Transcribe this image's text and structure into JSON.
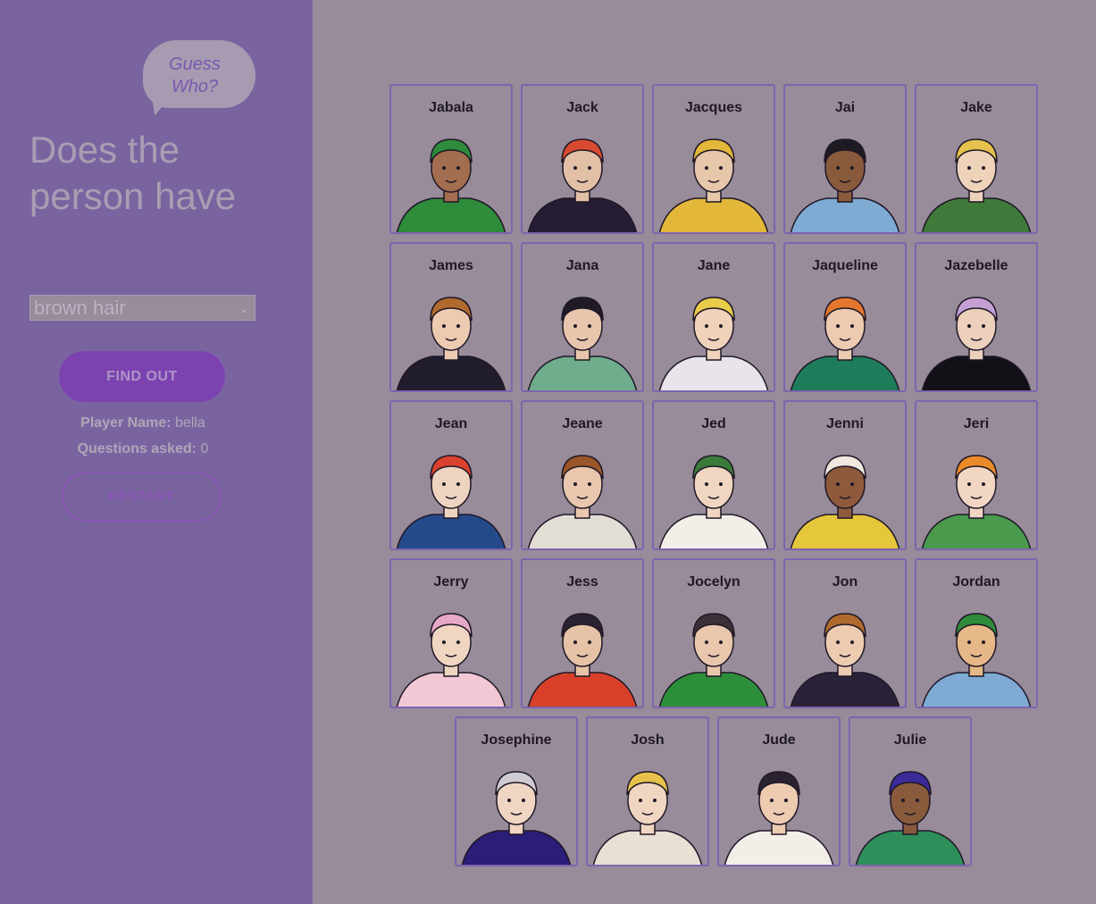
{
  "game": {
    "bubble_line1": "Guess",
    "bubble_line2": "Who?",
    "question": "Does the person have",
    "select_value": "brown hair",
    "find_out_label": "FIND OUT",
    "player_name_label": "Player Name:",
    "player_name": "bella",
    "questions_label": "Questions asked:",
    "questions_count": "0",
    "restart_label": "RESTART"
  },
  "characters": [
    {
      "name": "Jabala",
      "skin": "#a36d4f",
      "hair": "#2e8c3a",
      "shirt": "#2e8c3a"
    },
    {
      "name": "Jack",
      "skin": "#e2c0a6",
      "hair": "#d94a30",
      "shirt": "#241d33"
    },
    {
      "name": "Jacques",
      "skin": "#e7c7aa",
      "hair": "#e3b83a",
      "shirt": "#e3b83a"
    },
    {
      "name": "Jai",
      "skin": "#8a5a3c",
      "hair": "#1e1a22",
      "shirt": "#7eaad3"
    },
    {
      "name": "Jake",
      "skin": "#eed2ba",
      "hair": "#e6c24c",
      "shirt": "#3f7a3a"
    },
    {
      "name": "James",
      "skin": "#eccbb1",
      "hair": "#b06a2e",
      "shirt": "#211c2e"
    },
    {
      "name": "Jana",
      "skin": "#e8c6ad",
      "hair": "#1f1a24",
      "shirt": "#6fae8c"
    },
    {
      "name": "Jane",
      "skin": "#f0d2bb",
      "hair": "#e9cc4a",
      "shirt": "#e8e4ea"
    },
    {
      "name": "Jaqueline",
      "skin": "#eccbb1",
      "hair": "#e2772d",
      "shirt": "#1f7c5a"
    },
    {
      "name": "Jazebelle",
      "skin": "#ecd0bb",
      "hair": "#c4a0d4",
      "shirt": "#141018"
    },
    {
      "name": "Jean",
      "skin": "#eed3c0",
      "hair": "#d9422c",
      "shirt": "#254a8a"
    },
    {
      "name": "Jeane",
      "skin": "#e8c7ae",
      "hair": "#9a5528",
      "shirt": "#e2ddd5"
    },
    {
      "name": "Jed",
      "skin": "#f0d6c1",
      "hair": "#3a7a3a",
      "shirt": "#f2efe8"
    },
    {
      "name": "Jenni",
      "skin": "#8f5a3c",
      "hair": "#efe9e0",
      "shirt": "#e6c63a"
    },
    {
      "name": "Jeri",
      "skin": "#f1d7c3",
      "hair": "#ea8a2a",
      "shirt": "#4a9a4e"
    },
    {
      "name": "Jerry",
      "skin": "#f0d6c1",
      "hair": "#e6a8c8",
      "shirt": "#f2c8d4"
    },
    {
      "name": "Jess",
      "skin": "#e6c2a6",
      "hair": "#2a2230",
      "shirt": "#d8402a"
    },
    {
      "name": "Jocelyn",
      "skin": "#e9c7ad",
      "hair": "#3a3038",
      "shirt": "#2e8f3a"
    },
    {
      "name": "Jon",
      "skin": "#eccbb1",
      "hair": "#b06a2e",
      "shirt": "#2a2238"
    },
    {
      "name": "Jordan",
      "skin": "#e6b888",
      "hair": "#2e8c3a",
      "shirt": "#7eaad3"
    },
    {
      "name": "Josephine",
      "skin": "#efd5c2",
      "hair": "#cfcbd2",
      "shirt": "#2a1e78"
    },
    {
      "name": "Josh",
      "skin": "#f0d6c1",
      "hair": "#e6c24c",
      "shirt": "#e8e0d4"
    },
    {
      "name": "Jude",
      "skin": "#eccbb1",
      "hair": "#2a2230",
      "shirt": "#f3eee8"
    },
    {
      "name": "Julie",
      "skin": "#8a5a3c",
      "hair": "#3a2a9a",
      "shirt": "#2e8f5a"
    }
  ],
  "colors": {
    "sidebar": "#7a64a0",
    "board": "#988b9a",
    "accent": "#7c43b0",
    "card_border": "#7e64ae"
  }
}
